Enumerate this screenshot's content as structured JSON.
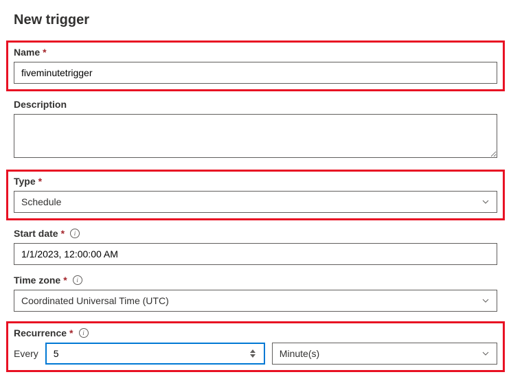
{
  "title": "New trigger",
  "fields": {
    "name": {
      "label": "Name",
      "value": "fiveminutetrigger"
    },
    "description": {
      "label": "Description",
      "value": ""
    },
    "type": {
      "label": "Type",
      "value": "Schedule"
    },
    "startDate": {
      "label": "Start date",
      "value": "1/1/2023, 12:00:00 AM"
    },
    "timeZone": {
      "label": "Time zone",
      "value": "Coordinated Universal Time (UTC)"
    },
    "recurrence": {
      "label": "Recurrence",
      "everyLabel": "Every",
      "value": "5",
      "unit": "Minute(s)"
    }
  }
}
